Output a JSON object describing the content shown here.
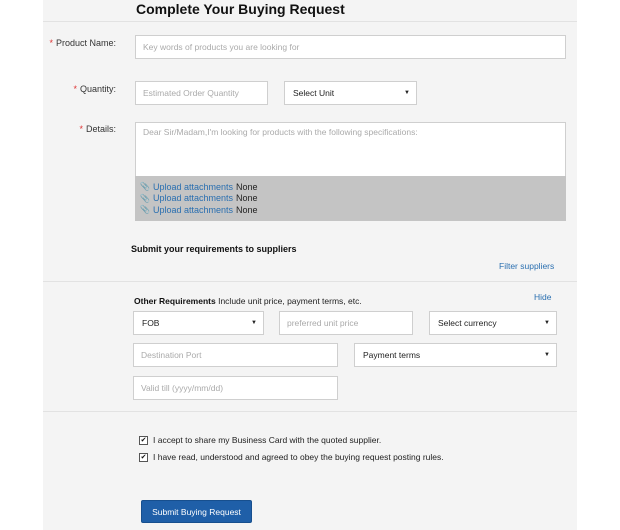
{
  "page_title": "Complete Your Buying Request",
  "required_mark": "*",
  "product_name": {
    "label": "Product Name:",
    "placeholder": "Key words of products you are looking for"
  },
  "quantity": {
    "label": "Quantity:",
    "placeholder": "Estimated Order Quantity",
    "unit_select": "Select Unit"
  },
  "details": {
    "label": "Details:",
    "placeholder": "Dear Sir/Madam,I'm looking for products with the following specifications:",
    "attachments": [
      {
        "link": "Upload attachments",
        "status": "None"
      },
      {
        "link": "Upload attachments",
        "status": "None"
      },
      {
        "link": "Upload attachments",
        "status": "None"
      }
    ]
  },
  "submit_to_suppliers": "Submit your requirements to suppliers",
  "filter_suppliers": "Filter suppliers",
  "other_requirements": {
    "title": "Other Requirements",
    "subtitle": "Include unit price, payment terms, etc.",
    "hide": "Hide",
    "trade_terms": "FOB",
    "unit_price_placeholder": "preferred unit price",
    "currency_select": "Select currency",
    "destination_port_placeholder": "Destination Port",
    "payment_terms": "Payment terms",
    "valid_till_placeholder": "Valid till (yyyy/mm/dd)"
  },
  "agreements": [
    {
      "text": "I accept to share my Business Card with the quoted supplier.",
      "checked": true
    },
    {
      "text": "I have read, understood and agreed to obey the buying request posting rules.",
      "checked": true
    }
  ],
  "check_glyph": "✔",
  "caret_glyph": "▼",
  "clip_glyph": "📎",
  "submit_button": "Submit Buying Request",
  "colors": {
    "accent": "#1f5fa8",
    "link": "#2a6fb0",
    "required": "#dd3333",
    "panel_bg": "#f4f4f4"
  }
}
